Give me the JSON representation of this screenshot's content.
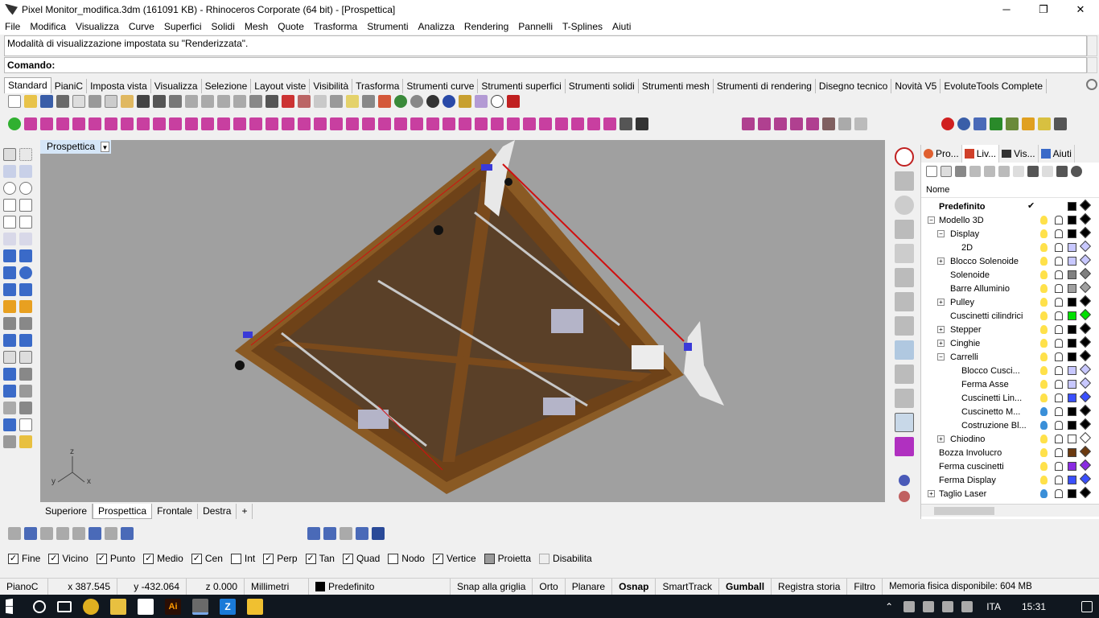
{
  "window": {
    "title": "Pixel Monitor_modifica.3dm (161091 KB) - Rhinoceros Corporate (64 bit) - [Prospettica]",
    "minimize_icon": "─",
    "restore_icon": "❐",
    "close_icon": "✕"
  },
  "menu": [
    "File",
    "Modifica",
    "Visualizza",
    "Curve",
    "Superfici",
    "Solidi",
    "Mesh",
    "Quote",
    "Trasforma",
    "Strumenti",
    "Analizza",
    "Rendering",
    "Pannelli",
    "T-Splines",
    "Aiuti"
  ],
  "command": {
    "history": "Modalità di visualizzazione impostata su \"Renderizzata\".",
    "prompt": "Comando:"
  },
  "toolbar_tabs": [
    "Standard",
    "PianiC",
    "Imposta vista",
    "Visualizza",
    "Selezione",
    "Layout viste",
    "Visibilità",
    "Trasforma",
    "Strumenti curve",
    "Strumenti superfici",
    "Strumenti solidi",
    "Strumenti mesh",
    "Strumenti di rendering",
    "Disegno tecnico",
    "Novità V5",
    "EvoluteTools Complete"
  ],
  "viewport": {
    "name": "Prospettica",
    "dropdown": "▼",
    "axis_z": "z",
    "axis_y": "y",
    "axis_x": "x"
  },
  "viewport_tabs": [
    "Superiore",
    "Prospettica",
    "Frontale",
    "Destra"
  ],
  "viewport_add": "+",
  "panel": {
    "tabs": [
      "Pro...",
      "Liv...",
      "Vis...",
      "Aiuti"
    ],
    "header": "Nome",
    "layers": [
      {
        "name": "Predefinito",
        "indent": 0,
        "expander": "",
        "bold": true,
        "check": "✔",
        "bulb": "",
        "color": "#000000"
      },
      {
        "name": "Modello 3D",
        "indent": 0,
        "expander": "−",
        "bold": false,
        "check": "",
        "bulb": "#ffe14a",
        "color": "#000000"
      },
      {
        "name": "Display",
        "indent": 1,
        "expander": "−",
        "bold": false,
        "check": "",
        "bulb": "#ffe14a",
        "color": "#000000"
      },
      {
        "name": "2D",
        "indent": 2,
        "expander": "",
        "bold": false,
        "check": "",
        "bulb": "#ffe14a",
        "color": "#c8c8ff"
      },
      {
        "name": "Blocco Solenoide",
        "indent": 1,
        "expander": "+",
        "bold": false,
        "check": "",
        "bulb": "#ffe14a",
        "color": "#c8c8ff"
      },
      {
        "name": "Solenoide",
        "indent": 1,
        "expander": "",
        "bold": false,
        "check": "",
        "bulb": "#ffe14a",
        "color": "#808080"
      },
      {
        "name": "Barre Alluminio",
        "indent": 1,
        "expander": "",
        "bold": false,
        "check": "",
        "bulb": "#ffe14a",
        "color": "#a0a0a0"
      },
      {
        "name": "Pulley",
        "indent": 1,
        "expander": "+",
        "bold": false,
        "check": "",
        "bulb": "#ffe14a",
        "color": "#000000"
      },
      {
        "name": "Cuscinetti cilindrici",
        "indent": 1,
        "expander": "",
        "bold": false,
        "check": "",
        "bulb": "#ffe14a",
        "color": "#00e000"
      },
      {
        "name": "Stepper",
        "indent": 1,
        "expander": "+",
        "bold": false,
        "check": "",
        "bulb": "#ffe14a",
        "color": "#000000"
      },
      {
        "name": "Cinghie",
        "indent": 1,
        "expander": "+",
        "bold": false,
        "check": "",
        "bulb": "#ffe14a",
        "color": "#000000"
      },
      {
        "name": "Carrelli",
        "indent": 1,
        "expander": "−",
        "bold": false,
        "check": "",
        "bulb": "#ffe14a",
        "color": "#000000"
      },
      {
        "name": "Blocco Cusci...",
        "indent": 2,
        "expander": "",
        "bold": false,
        "check": "",
        "bulb": "#ffe14a",
        "color": "#c8c8ff"
      },
      {
        "name": "Ferma Asse",
        "indent": 2,
        "expander": "",
        "bold": false,
        "check": "",
        "bulb": "#ffe14a",
        "color": "#c8c8ff"
      },
      {
        "name": "Cuscinetti Lin...",
        "indent": 2,
        "expander": "",
        "bold": false,
        "check": "",
        "bulb": "#ffe14a",
        "color": "#3a50ff"
      },
      {
        "name": "Cuscinetto M...",
        "indent": 2,
        "expander": "",
        "bold": false,
        "check": "",
        "bulb": "#3a8fd8",
        "color": "#000000"
      },
      {
        "name": "Costruzione Bl...",
        "indent": 2,
        "expander": "",
        "bold": false,
        "check": "",
        "bulb": "#3a8fd8",
        "color": "#000000"
      },
      {
        "name": "Chiodino",
        "indent": 1,
        "expander": "+",
        "bold": false,
        "check": "",
        "bulb": "#ffe14a",
        "color": "#ffffff"
      },
      {
        "name": "Bozza Involucro",
        "indent": 0,
        "expander": "",
        "bold": false,
        "check": "",
        "bulb": "#ffe14a",
        "color": "#6b3a10"
      },
      {
        "name": "Ferma cuscinetti",
        "indent": 0,
        "expander": "",
        "bold": false,
        "check": "",
        "bulb": "#ffe14a",
        "color": "#8a2be2"
      },
      {
        "name": "Ferma Display",
        "indent": 0,
        "expander": "",
        "bold": false,
        "check": "",
        "bulb": "#ffe14a",
        "color": "#3a50ff"
      },
      {
        "name": "Taglio Laser",
        "indent": 0,
        "expander": "+",
        "bold": false,
        "check": "",
        "bulb": "#3a8fd8",
        "color": "#000000"
      }
    ]
  },
  "osnap": [
    {
      "label": "Fine",
      "checked": true
    },
    {
      "label": "Vicino",
      "checked": true
    },
    {
      "label": "Punto",
      "checked": true
    },
    {
      "label": "Medio",
      "checked": true
    },
    {
      "label": "Cen",
      "checked": true
    },
    {
      "label": "Int",
      "checked": false
    },
    {
      "label": "Perp",
      "checked": true
    },
    {
      "label": "Tan",
      "checked": true
    },
    {
      "label": "Quad",
      "checked": true
    },
    {
      "label": "Nodo",
      "checked": false
    },
    {
      "label": "Vertice",
      "checked": true
    },
    {
      "label": "Proietta",
      "checked": false
    },
    {
      "label": "Disabilita",
      "checked": false
    }
  ],
  "status": {
    "plane": "PianoC",
    "x": "x 387.545",
    "y": "y -432.064",
    "z": "z 0.000",
    "units": "Millimetri",
    "layer": "Predefinito",
    "snap": "Snap alla griglia",
    "orto": "Orto",
    "planar": "Planare",
    "osnap": "Osnap",
    "smarttrack": "SmartTrack",
    "gumball": "Gumball",
    "history": "Registra storia",
    "filter": "Filtro",
    "memory": "Memoria fisica disponibile: 604 MB"
  },
  "taskbar": {
    "lang": "ITA",
    "time": "15:31",
    "ai_label": "Ai",
    "z_label": "Z"
  },
  "colors": {
    "accent": "#0078d7",
    "viewport_bg": "#a0a0a0",
    "wood": "#8a5a24"
  }
}
